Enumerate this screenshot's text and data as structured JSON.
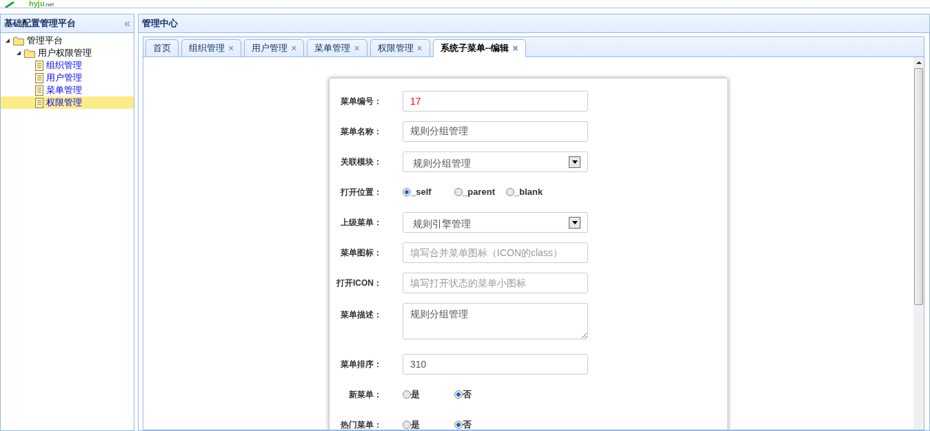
{
  "logo": {
    "name": "hyju",
    "suffix": ".net"
  },
  "sidebar": {
    "title": "基础配置管理平台",
    "collapse": "«",
    "tree": [
      {
        "label": "管理平台",
        "kind": "folder",
        "expanded": true,
        "selected": false,
        "children": [
          {
            "label": "用户权限管理",
            "kind": "folder",
            "expanded": true,
            "selected": false,
            "children": [
              {
                "label": "组织管理",
                "kind": "page",
                "selected": false
              },
              {
                "label": "用户管理",
                "kind": "page",
                "selected": false
              },
              {
                "label": "菜单管理",
                "kind": "page",
                "selected": false
              },
              {
                "label": "权限管理",
                "kind": "page",
                "selected": true
              }
            ]
          }
        ]
      }
    ]
  },
  "main": {
    "title": "管理中心",
    "tabs": [
      {
        "label": "首页",
        "selected": false
      },
      {
        "label": "组织管理",
        "close": "×",
        "selected": false
      },
      {
        "label": "用户管理",
        "close": "×",
        "selected": false
      },
      {
        "label": "菜单管理",
        "close": "×",
        "selected": false
      },
      {
        "label": "权限管理",
        "close": "×",
        "selected": false
      },
      {
        "label": "系统子菜单--编辑",
        "close": "×",
        "selected": true
      }
    ],
    "form": [
      {
        "kind": "text",
        "label": "菜单编号：",
        "value": "17",
        "highlight": true
      },
      {
        "kind": "text",
        "label": "菜单名称：",
        "value": "规则分组管理",
        "highlight": false
      },
      {
        "kind": "select",
        "label": "关联模块：",
        "value": "规则分组管理"
      },
      {
        "kind": "radio",
        "label": "打开位置：",
        "options": [
          {
            "label": "_self",
            "selected": true
          },
          {
            "label": "_parent",
            "selected": false
          },
          {
            "label": "_blank",
            "selected": false
          }
        ]
      },
      {
        "kind": "select",
        "label": "上级菜单：",
        "value": "规则引擎管理"
      },
      {
        "kind": "text",
        "label": "菜单图标：",
        "placeholder": "填写合并菜单图标（ICON的class）"
      },
      {
        "kind": "text",
        "label": "打开ICON：",
        "placeholder": "填写打开状态的菜单小图标"
      },
      {
        "kind": "textarea",
        "label": "菜单描述：",
        "value": "规则分组管理"
      },
      {
        "kind": "text",
        "label": "菜单排序：",
        "value": "310",
        "highlight": false
      },
      {
        "kind": "radio",
        "label": "新菜单：",
        "options": [
          {
            "label": "是",
            "selected": false
          },
          {
            "label": "否",
            "selected": true
          }
        ]
      },
      {
        "kind": "radio",
        "label": "热门菜单：",
        "options": [
          {
            "label": "是",
            "selected": false
          },
          {
            "label": "否",
            "selected": true
          }
        ]
      }
    ]
  }
}
